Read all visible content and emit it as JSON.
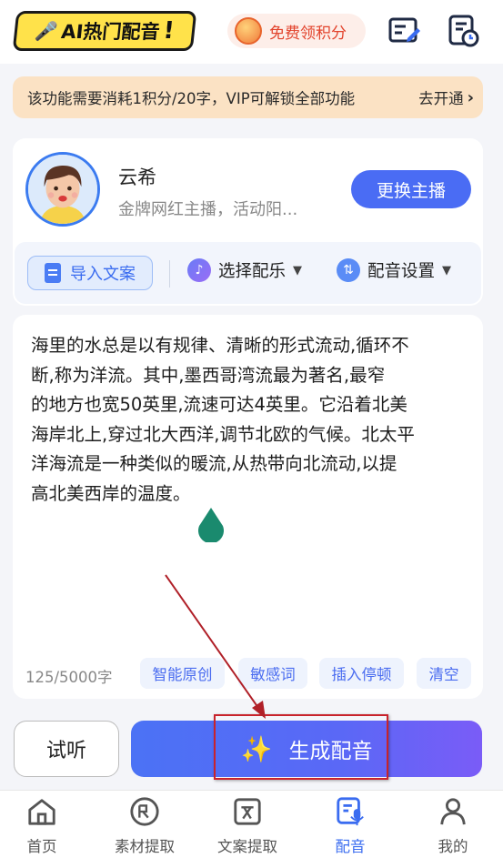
{
  "header": {
    "logo_text": "AI热门配音",
    "logo_bang": "!",
    "points_label": "免费领积分",
    "icons": [
      "edit-document-icon",
      "history-clock-icon"
    ]
  },
  "banner": {
    "text": "该功能需要消耗1积分/20字，VIP可解锁全部功能",
    "action": "去开通"
  },
  "anchor": {
    "name": "云希",
    "desc": "金牌网红主播，活动阳...",
    "change_label": "更换主播"
  },
  "toolbar": {
    "import_label": "导入文案",
    "music_label": "选择配乐",
    "settings_label": "配音设置"
  },
  "editor": {
    "lines": [
      "海里的水总是以有规律、清晰的形式流动,循环不",
      "断,称为洋流。其中,墨西哥湾流最为著名,最窄",
      "的地方也宽50英里,流速可达4英里。它沿着北美",
      "海岸北上,穿过北大西洋,调节北欧的气候。北太平",
      "洋海流是一种类似的暖流,从热带向北流动,以提",
      "高北美西岸的温度。"
    ],
    "count": "125/5000字",
    "chips": [
      "智能原创",
      "敏感词",
      "插入停顿",
      "清空"
    ]
  },
  "actions": {
    "listen_label": "试听",
    "generate_label": "生成配音"
  },
  "nav": {
    "items": [
      {
        "label": "首页",
        "icon": "home-icon"
      },
      {
        "label": "素材提取",
        "icon": "material-extract-icon"
      },
      {
        "label": "文案提取",
        "icon": "text-extract-icon"
      },
      {
        "label": "配音",
        "icon": "dubbing-icon"
      },
      {
        "label": "我的",
        "icon": "profile-icon"
      }
    ],
    "active": "配音"
  },
  "colors": {
    "accent": "#4a6cf4",
    "logo_yellow": "#ffe24a",
    "points_red": "#e2432c",
    "banner_bg": "#fbe2c4",
    "annotation_red": "#c8232c"
  }
}
